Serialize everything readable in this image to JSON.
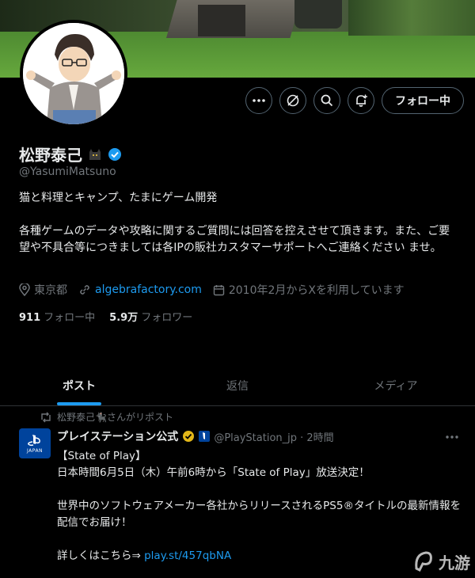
{
  "profile": {
    "display_name": "松野泰己",
    "handle": "@YasumiMatsuno",
    "bio_line1": "猫と料理とキャンプ、たまにゲーム開発",
    "bio_line2": "各種ゲームのデータや攻略に関するご質問には回答を控えさせて頂きます。また、ご要望や不具合等につきましては各IPの販社カスタマーサポートへご連絡ください ませ。",
    "location": "東京都",
    "website": "algebrafactory.com",
    "joined": "2010年2月からXを利用しています",
    "following_count": "911",
    "following_label": "フォロー中",
    "followers_count": "5.9万",
    "followers_label": "フォロワー"
  },
  "actions": {
    "follow_label": "フォロー中"
  },
  "tabs": [
    {
      "label": "ポスト"
    },
    {
      "label": "返信"
    },
    {
      "label": "メディア"
    }
  ],
  "post": {
    "repost_text": "松野泰己🐈‍⬛さんがリポスト",
    "account_name": "プレイステーション公式",
    "account_meta": "@PlayStation_jp · 2時間",
    "avatar_text": "JAPAN",
    "line1": "【State of Play】",
    "line2": "日本時間6月5日（木）午前6時から「State of Play」放送決定！",
    "line3": "世界中のソフトウェアメーカー各社からリリースされるPS5®タイトルの最新情報を配信でお届け！",
    "line4_prefix": "詳しくはこちら⇒ ",
    "line4_link": "play.st/457qbNA"
  },
  "watermark": "九游",
  "colors": {
    "accent": "#1d9bf0",
    "verified_gold": "#e2b719",
    "background": "#000000"
  },
  "icons": [
    "more-icon",
    "hide-reposts-icon",
    "search-icon",
    "notification-bell-icon",
    "verified-badge-icon",
    "location-icon",
    "link-icon",
    "calendar-icon",
    "repost-icon",
    "playstation-logo-icon"
  ]
}
